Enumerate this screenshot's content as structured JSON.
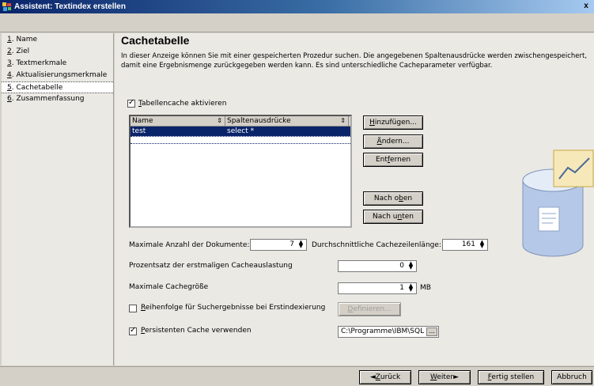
{
  "window": {
    "title": "Assistent: Textindex erstellen",
    "close_glyph": "x"
  },
  "nav": {
    "items": [
      {
        "key": "1",
        "label": ". Name",
        "selected": false
      },
      {
        "key": "2",
        "label": ". Ziel",
        "selected": false
      },
      {
        "key": "3",
        "label": ". Textmerkmale",
        "selected": false
      },
      {
        "key": "4",
        "label": ". Aktualisierungsmerkmale",
        "selected": false
      },
      {
        "key": "5",
        "label": ". Cachetabelle",
        "selected": true
      },
      {
        "key": "6",
        "label": ". Zusammenfassung",
        "selected": false
      }
    ]
  },
  "page": {
    "title": "Cachetabelle",
    "description": "In dieser Anzeige können Sie mit einer gespeicherten Prozedur suchen. Die angegebenen Spaltenausdrücke werden zwischengespeichert, damit eine Ergebnismenge zurückgegeben werden kann. Es sind unterschiedliche Cacheparameter verfügbar."
  },
  "cache": {
    "enable_checked": true,
    "enable_key": "T",
    "enable_rest": "abellencache aktivieren",
    "table": {
      "columns": [
        "Name",
        "Spaltenausdrücke"
      ],
      "sort_glyph": "⇕",
      "rows": [
        {
          "name": "test",
          "expr": "select *"
        }
      ]
    },
    "buttons": {
      "add_key": "H",
      "add_rest": "inzufügen...",
      "change_pre": "Ä",
      "change_rest": "ndern...",
      "remove_pre": "Ent",
      "remove_key": "f",
      "remove_rest": "ernen",
      "up_pre": "Nach o",
      "up_key": "b",
      "up_rest": "en",
      "down_pre": "Nach u",
      "down_key": "n",
      "down_rest": "ten"
    },
    "max_docs_label": "Maximale Anzahl der Dokumente:",
    "max_docs_value": "7",
    "avg_row_label": "Durchschnittliche Cachezeilenlänge:",
    "avg_row_value": "161",
    "initial_pct_label": "Prozentsatz der erstmaligen Cacheauslastung",
    "initial_pct_value": "0",
    "max_size_label": "Maximale Cachegröße",
    "max_size_value": "1",
    "max_size_unit": "MB",
    "order_checked": false,
    "order_key": "R",
    "order_rest": "eihenfolge für Suchergebnisse bei Erstindexierung",
    "define_key": "D",
    "define_rest": "efinieren...",
    "persistent_checked": true,
    "persistent_key": "P",
    "persistent_rest": "ersistenten Cache verwenden",
    "path_value": "C:\\Programme\\IBM\\SQL",
    "browse_label": "..."
  },
  "footer": {
    "back_glyph": "◄",
    "back_key": "Z",
    "back_rest": "urück",
    "next_key": "W",
    "next_rest": "eiter",
    "next_glyph": "►",
    "finish_key": "F",
    "finish_rest": "ertig stellen",
    "cancel_label": "Abbruch"
  },
  "icons": [
    "app-icon",
    "close-icon",
    "database-chart-icon",
    "sort-icon",
    "spinner-icon"
  ]
}
